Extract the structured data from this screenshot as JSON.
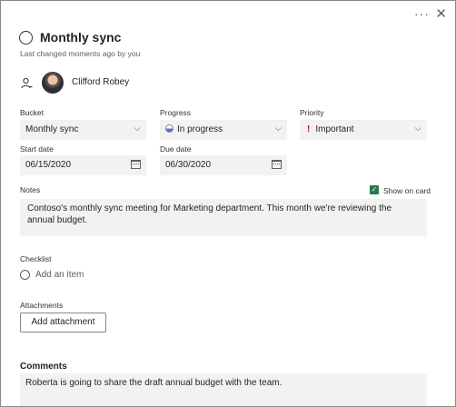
{
  "header": {
    "more_icon": "more-horizontal-icon",
    "close_icon": "close-icon"
  },
  "task": {
    "title": "Monthly sync",
    "subtitle": "Last changed moments ago by you",
    "assignee": "Clifford Robey"
  },
  "fields": {
    "bucket": {
      "label": "Bucket",
      "value": "Monthly sync"
    },
    "progress": {
      "label": "Progress",
      "value": "In progress"
    },
    "priority": {
      "label": "Priority",
      "value": "Important",
      "mark": "!"
    },
    "start_date": {
      "label": "Start date",
      "value": "06/15/2020"
    },
    "due_date": {
      "label": "Due date",
      "value": "06/30/2020"
    }
  },
  "notes": {
    "label": "Notes",
    "show_on_card": "Show on card",
    "text": "Contoso's monthly sync meeting for Marketing department. This month we're reviewing the annual budget."
  },
  "checklist": {
    "label": "Checklist",
    "add_item": "Add an item"
  },
  "attachments": {
    "label": "Attachments",
    "button": "Add attachment"
  },
  "comments": {
    "label": "Comments",
    "text": "Roberta is going to share the draft annual budget with the team."
  },
  "colors": {
    "checkbox_green": "#237b4b",
    "priority_red": "#c50f1f",
    "progress_blue": "#4f6bed"
  }
}
